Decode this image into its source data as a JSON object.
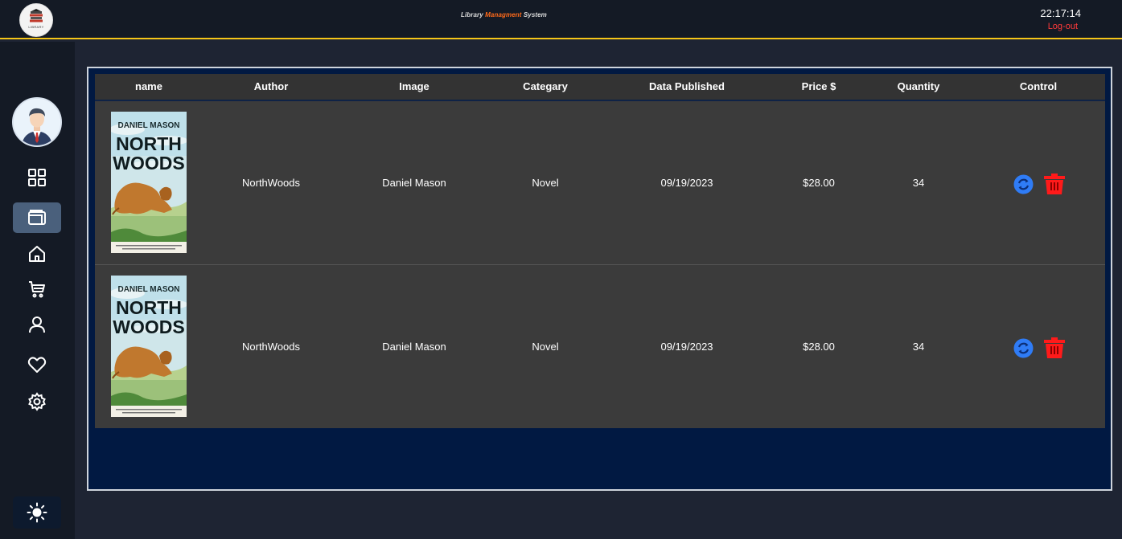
{
  "header": {
    "logo_label": "LIBRARY",
    "title_part1": "Library ",
    "title_part2": "Managment",
    "title_part3": " System",
    "clock": "22:17:14",
    "logout_label": "Log-out"
  },
  "sidebar": {
    "items": [
      {
        "icon": "grid-icon",
        "active": false
      },
      {
        "icon": "wallet-icon",
        "active": true
      },
      {
        "icon": "home-icon",
        "active": false
      },
      {
        "icon": "cart-icon",
        "active": false
      },
      {
        "icon": "user-icon",
        "active": false
      },
      {
        "icon": "heart-icon",
        "active": false
      },
      {
        "icon": "gear-icon",
        "active": false
      }
    ],
    "theme_toggle_icon": "sun-icon"
  },
  "table": {
    "columns": [
      "name",
      "Author",
      "Image",
      "Categary",
      "Data Published",
      "Price $",
      "Quantity",
      "Control"
    ],
    "rows": [
      {
        "cover_author": "DANIEL MASON",
        "cover_title_1": "NORTH",
        "cover_title_2": "WOODS",
        "col2": "NorthWoods",
        "col3": "Daniel Mason",
        "category": "Novel",
        "date": "09/19/2023",
        "price": "$28.00",
        "quantity": "34"
      },
      {
        "cover_author": "DANIEL MASON",
        "cover_title_1": "NORTH",
        "cover_title_2": "WOODS",
        "col2": "NorthWoods",
        "col3": "Daniel Mason",
        "category": "Novel",
        "date": "09/19/2023",
        "price": "$28.00",
        "quantity": "34"
      }
    ]
  },
  "colors": {
    "accent_yellow": "#f5c518",
    "title_accent": "#ff6a1a",
    "logout_red": "#ff3a3a",
    "update_blue": "#2f7cf6",
    "delete_red": "#ff1a1a"
  }
}
